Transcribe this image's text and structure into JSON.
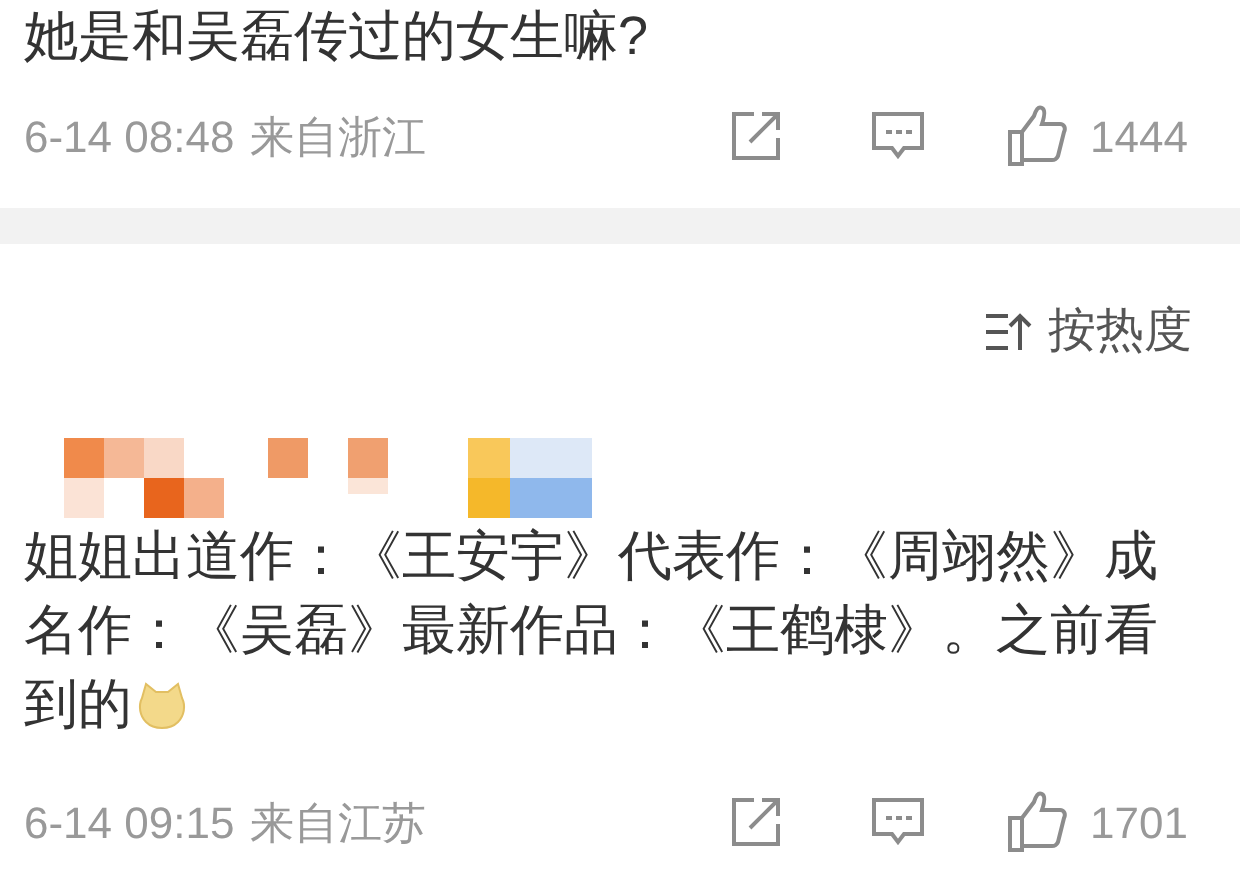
{
  "comments": [
    {
      "text": "她是和吴磊传过的女生嘛?",
      "time": "6-14 08:48",
      "location": "来自浙江",
      "likes": "1444"
    },
    {
      "text": "姐姐出道作：《王安宇》代表作：《周翊然》成名作：《吴磊》最新作品：《王鹤棣》。之前看",
      "text_continued": "到的",
      "time": "6-14 09:15",
      "location": "来自江苏",
      "likes": "1701"
    }
  ],
  "sort": {
    "label": "按热度"
  }
}
